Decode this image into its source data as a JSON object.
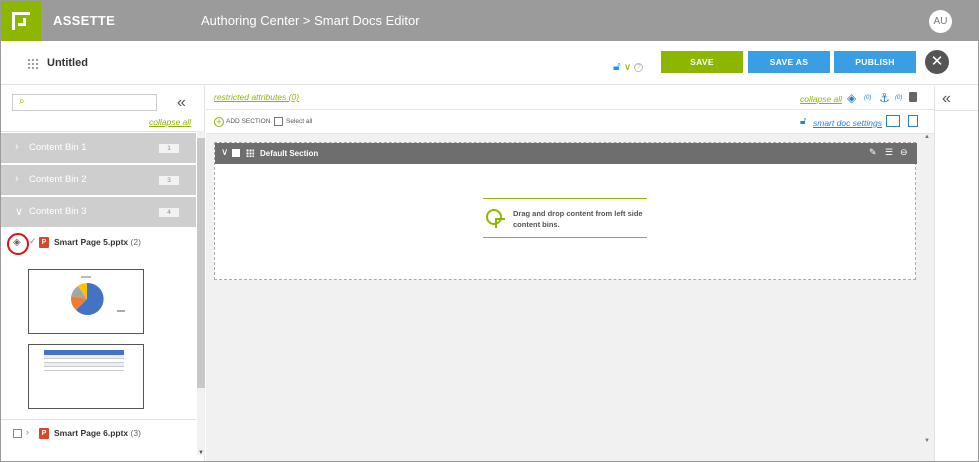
{
  "header": {
    "brand": "ASSETTE",
    "breadcrumb": "Authoring Center > Smart Docs Editor",
    "user_initials": "AU"
  },
  "titlebar": {
    "doc_title": "Untitled",
    "save_label": "SAVE",
    "save_as_label": "SAVE AS",
    "publish_label": "PUBLISH",
    "help_mark": "?"
  },
  "left_panel": {
    "search_placeholder": "",
    "collapse_all": "collapse all",
    "bins": [
      {
        "label": "Content Bin 1",
        "count": "1"
      },
      {
        "label": "Content Bin 2",
        "count": "3"
      },
      {
        "label": "Content Bin 3",
        "count": "4"
      }
    ],
    "items": [
      {
        "name": "Smart Page 5.pptx",
        "count": "(2)"
      },
      {
        "name": "Smart Page 6.pptx",
        "count": "(3)"
      }
    ]
  },
  "center": {
    "restricted_attributes": "restricted attributes (0)",
    "collapse_all": "collapse all",
    "badge_1": "(0)",
    "badge_2": "(0)",
    "add_section": "ADD SECTION",
    "select_all": "Select all",
    "smart_doc_settings": "smart doc settings",
    "section_title": "Default Section",
    "drop_hint": "Drag and drop content from left side content bins."
  },
  "colors": {
    "accent_green": "#8db600",
    "accent_blue": "#3a9ee4",
    "header_gray": "#9b9b9b",
    "bin_gray": "#cecece"
  }
}
